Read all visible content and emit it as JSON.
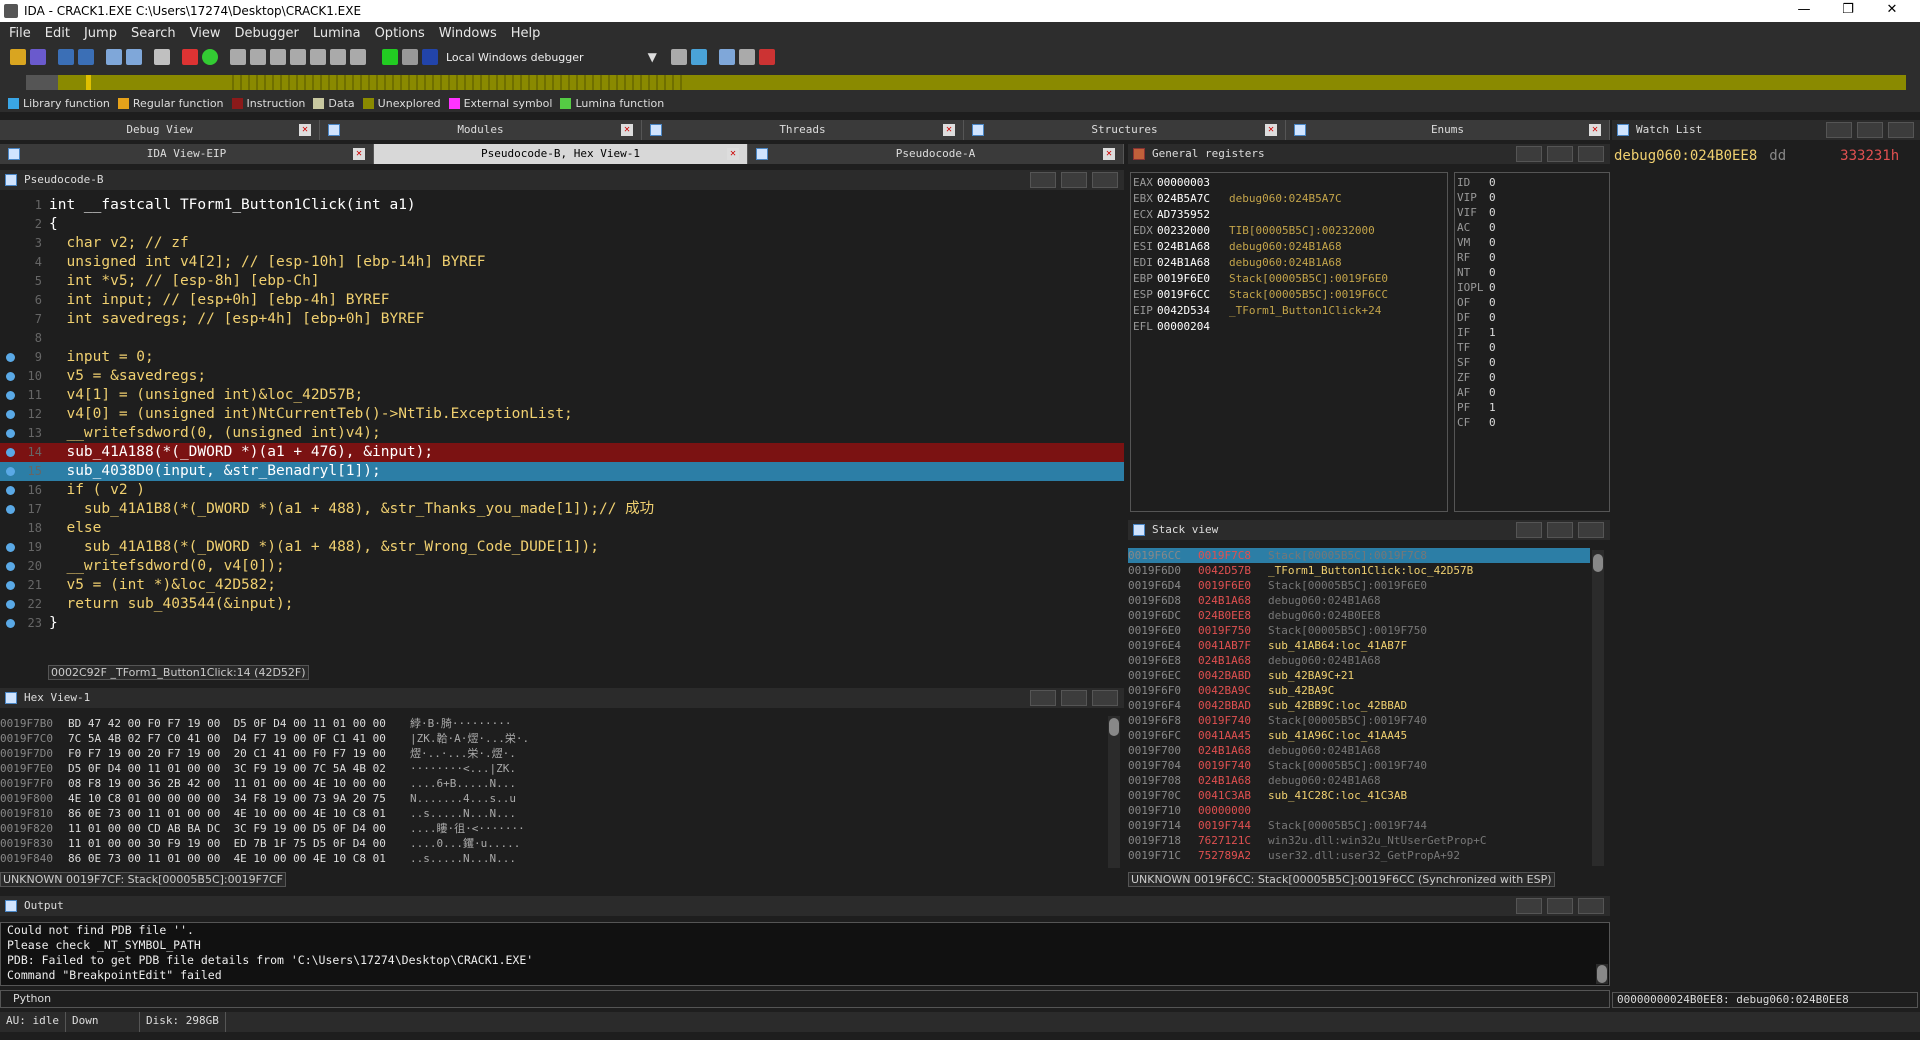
{
  "window": {
    "title": "IDA - CRACK1.EXE C:\\Users\\17274\\Desktop\\CRACK1.EXE",
    "minimize": "—",
    "maximize": "❐",
    "close": "✕"
  },
  "menu": [
    "File",
    "Edit",
    "Jump",
    "Search",
    "View",
    "Debugger",
    "Lumina",
    "Options",
    "Windows",
    "Help"
  ],
  "toolbar": {
    "debugger_select": "Local Windows debugger"
  },
  "legend": [
    {
      "label": "Library function",
      "color": "#3aa6e6"
    },
    {
      "label": "Regular function",
      "color": "#e6a21a"
    },
    {
      "label": "Instruction",
      "color": "#8b1a1a"
    },
    {
      "label": "Data",
      "color": "#c8c8a0"
    },
    {
      "label": "Unexplored",
      "color": "#8a8a00"
    },
    {
      "label": "External symbol",
      "color": "#ff33ff"
    },
    {
      "label": "Lumina function",
      "color": "#55cc44"
    }
  ],
  "tabs_top": [
    "Debug View",
    "Modules",
    "Threads",
    "Structures",
    "Enums"
  ],
  "tabs_second": [
    "IDA View-EIP",
    "Pseudocode-B, Hex View-1",
    "Pseudocode-A"
  ],
  "panels": {
    "pseudocode": "Pseudocode-B",
    "general_registers": "General registers",
    "watch_list": "Watch List",
    "stack_view": "Stack view",
    "hex_view": "Hex View-1",
    "output": "Output"
  },
  "code_lines": [
    {
      "n": "1",
      "t": "int __fastcall TForm1_Button1Click(int a1)",
      "bp": false
    },
    {
      "n": "2",
      "t": "{",
      "bp": false
    },
    {
      "n": "3",
      "t": "  char v2; // zf",
      "bp": false
    },
    {
      "n": "4",
      "t": "  unsigned int v4[2]; // [esp-10h] [ebp-14h] BYREF",
      "bp": false
    },
    {
      "n": "5",
      "t": "  int *v5; // [esp-8h] [ebp-Ch]",
      "bp": false
    },
    {
      "n": "6",
      "t": "  int input; // [esp+0h] [ebp-4h] BYREF",
      "bp": false
    },
    {
      "n": "7",
      "t": "  int savedregs; // [esp+4h] [ebp+0h] BYREF",
      "bp": false
    },
    {
      "n": "8",
      "t": "",
      "bp": false
    },
    {
      "n": "9",
      "t": "  input = 0;",
      "bp": true
    },
    {
      "n": "10",
      "t": "  v5 = &savedregs;",
      "bp": true
    },
    {
      "n": "11",
      "t": "  v4[1] = (unsigned int)&loc_42D57B;",
      "bp": true
    },
    {
      "n": "12",
      "t": "  v4[0] = (unsigned int)NtCurrentTeb()->NtTib.ExceptionList;",
      "bp": true
    },
    {
      "n": "13",
      "t": "  __writefsdword(0, (unsigned int)v4);",
      "bp": true
    },
    {
      "n": "14",
      "t": "  sub_41A188(*(_DWORD *)(a1 + 476), &input);",
      "bp": true,
      "hl": "red"
    },
    {
      "n": "15",
      "t": "  sub_4038D0(input, &str_Benadryl[1]);",
      "bp": true,
      "hl": "blue"
    },
    {
      "n": "16",
      "t": "  if ( v2 )",
      "bp": true
    },
    {
      "n": "17",
      "t": "    sub_41A1B8(*(_DWORD *)(a1 + 488), &str_Thanks_you_made[1]);// 成功",
      "bp": true
    },
    {
      "n": "18",
      "t": "  else",
      "bp": false
    },
    {
      "n": "19",
      "t": "    sub_41A1B8(*(_DWORD *)(a1 + 488), &str_Wrong_Code_DUDE[1]);",
      "bp": true
    },
    {
      "n": "20",
      "t": "  __writefsdword(0, v4[0]);",
      "bp": true
    },
    {
      "n": "21",
      "t": "  v5 = (int *)&loc_42D582;",
      "bp": true
    },
    {
      "n": "22",
      "t": "  return sub_403544(&input);",
      "bp": true
    },
    {
      "n": "23",
      "t": "}",
      "bp": true
    }
  ],
  "code_status": "0002C92F _TForm1_Button1Click:14 (42D52F)",
  "hex_rows": [
    {
      "a": "0019F7B0",
      "b": "BD 47 42 00 F0 F7 19 00  D5 0F D4 00 11 01 00 00",
      "c": "綍·B·䐀·········"
    },
    {
      "a": "0019F7C0",
      "b": "7C 5A 4B 02 F7 C0 41 00  D4 F7 19 00 0F C1 41 00",
      "c": "|ZK.韐·A·熤·...栄·."
    },
    {
      "a": "0019F7D0",
      "b": "F0 F7 19 00 20 F7 19 00  20 C1 41 00 F0 F7 19 00",
      "c": "熤·..·...栄·.熤·."
    },
    {
      "a": "0019F7E0",
      "b": "D5 0F D4 00 11 01 00 00  3C F9 19 00 7C 5A 4B 02",
      "c": "········<...|ZK."
    },
    {
      "a": "0019F7F0",
      "b": "08 F8 19 00 36 2B 42 00  11 01 00 00 4E 10 00 00",
      "c": "....6+B.....N..."
    },
    {
      "a": "0019F800",
      "b": "4E 10 C8 01 00 00 00 00  34 F8 19 00 73 9A 20 75",
      "c": "N.......4...s..u"
    },
    {
      "a": "0019F810",
      "b": "86 0E 73 00 11 01 00 00  4E 10 00 00 4E 10 C8 01",
      "c": "..s.....N...N..."
    },
    {
      "a": "0019F820",
      "b": "11 01 00 00 CD AB BA DC  3C F9 19 00 D5 0F D4 00",
      "c": "....瞜·徂·<·······"
    },
    {
      "a": "0019F830",
      "b": "11 01 00 00 30 F9 19 00  ED 7B 1F 75 D5 0F D4 00",
      "c": "....0...钁·u....."
    },
    {
      "a": "0019F840",
      "b": "86 0E 73 00 11 01 00 00  4E 10 00 00 4E 10 C8 01",
      "c": "..s.....N...N..."
    }
  ],
  "hex_status": "UNKNOWN 0019F7CF: Stack[00005B5C]:0019F7CF",
  "registers": [
    {
      "n": "EAX",
      "v": "00000003",
      "d": ""
    },
    {
      "n": "EBX",
      "v": "024B5A7C",
      "d": "debug060:024B5A7C"
    },
    {
      "n": "ECX",
      "v": "AD735952",
      "d": ""
    },
    {
      "n": "EDX",
      "v": "00232000",
      "d": "TIB[00005B5C]:00232000"
    },
    {
      "n": "ESI",
      "v": "024B1A68",
      "d": "debug060:024B1A68"
    },
    {
      "n": "EDI",
      "v": "024B1A68",
      "d": "debug060:024B1A68"
    },
    {
      "n": "EBP",
      "v": "0019F6E0",
      "d": "Stack[00005B5C]:0019F6E0"
    },
    {
      "n": "ESP",
      "v": "0019F6CC",
      "d": "Stack[00005B5C]:0019F6CC"
    },
    {
      "n": "EIP",
      "v": "0042D534",
      "d": "_TForm1_Button1Click+24"
    },
    {
      "n": "EFL",
      "v": "00000204",
      "d": ""
    }
  ],
  "flags": [
    {
      "n": "ID",
      "v": "0"
    },
    {
      "n": "VIP",
      "v": "0"
    },
    {
      "n": "VIF",
      "v": "0"
    },
    {
      "n": "AC",
      "v": "0"
    },
    {
      "n": "VM",
      "v": "0"
    },
    {
      "n": "RF",
      "v": "0"
    },
    {
      "n": "NT",
      "v": "0"
    },
    {
      "n": "IOPL",
      "v": "0"
    },
    {
      "n": "OF",
      "v": "0"
    },
    {
      "n": "DF",
      "v": "0"
    },
    {
      "n": "IF",
      "v": "1"
    },
    {
      "n": "TF",
      "v": "0"
    },
    {
      "n": "SF",
      "v": "0"
    },
    {
      "n": "ZF",
      "v": "0"
    },
    {
      "n": "AF",
      "v": "0"
    },
    {
      "n": "PF",
      "v": "1"
    },
    {
      "n": "CF",
      "v": "0"
    }
  ],
  "stack_rows": [
    {
      "a": "0019F6CC",
      "v": "0019F7C8",
      "d": "Stack[00005B5C]:0019F7C8",
      "sel": true
    },
    {
      "a": "0019F6D0",
      "v": "0042D57B",
      "d": "_TForm1_Button1Click:loc_42D57B",
      "y": true
    },
    {
      "a": "0019F6D4",
      "v": "0019F6E0",
      "d": "Stack[00005B5C]:0019F6E0"
    },
    {
      "a": "0019F6D8",
      "v": "024B1A68",
      "d": "debug060:024B1A68"
    },
    {
      "a": "0019F6DC",
      "v": "024B0EE8",
      "d": "debug060:024B0EE8"
    },
    {
      "a": "0019F6E0",
      "v": "0019F750",
      "d": "Stack[00005B5C]:0019F750"
    },
    {
      "a": "0019F6E4",
      "v": "0041AB7F",
      "d": "sub_41AB64:loc_41AB7F",
      "y": true
    },
    {
      "a": "0019F6E8",
      "v": "024B1A68",
      "d": "debug060:024B1A68"
    },
    {
      "a": "0019F6EC",
      "v": "0042BABD",
      "d": "sub_42BA9C+21",
      "y": true
    },
    {
      "a": "0019F6F0",
      "v": "0042BA9C",
      "d": "sub_42BA9C",
      "y": true
    },
    {
      "a": "0019F6F4",
      "v": "0042BBAD",
      "d": "sub_42BB9C:loc_42BBAD",
      "y": true
    },
    {
      "a": "0019F6F8",
      "v": "0019F740",
      "d": "Stack[00005B5C]:0019F740"
    },
    {
      "a": "0019F6FC",
      "v": "0041AA45",
      "d": "sub_41A96C:loc_41AA45",
      "y": true
    },
    {
      "a": "0019F700",
      "v": "024B1A68",
      "d": "debug060:024B1A68"
    },
    {
      "a": "0019F704",
      "v": "0019F740",
      "d": "Stack[00005B5C]:0019F740"
    },
    {
      "a": "0019F708",
      "v": "024B1A68",
      "d": "debug060:024B1A68"
    },
    {
      "a": "0019F70C",
      "v": "0041C3AB",
      "d": "sub_41C28C:loc_41C3AB",
      "y": true
    },
    {
      "a": "0019F710",
      "v": "00000000",
      "d": ""
    },
    {
      "a": "0019F714",
      "v": "0019F744",
      "d": "Stack[00005B5C]:0019F744"
    },
    {
      "a": "0019F718",
      "v": "7627121C",
      "d": "win32u.dll:win32u_NtUserGetProp+C"
    },
    {
      "a": "0019F71C",
      "v": "752789A2",
      "d": "user32.dll:user32_GetPropA+92"
    }
  ],
  "stack_status": "UNKNOWN 0019F6CC: Stack[00005B5C]:0019F6CC (Synchronized with ESP)",
  "watch": {
    "addr": "debug060:024B0EE8",
    "dir": "dd",
    "val": "333231h"
  },
  "output_lines": [
    "Could not find PDB file ''.",
    "Please check _NT_SYMBOL_PATH",
    "PDB: Failed to get PDB file details from 'C:\\Users\\17274\\Desktop\\CRACK1.EXE'",
    "Command \"BreakpointEdit\" failed"
  ],
  "python_label": "Python",
  "status": {
    "au": "AU:  idle",
    "dir": "Down",
    "disk": "Disk: 298GB"
  },
  "right_status": "00000000024B0EE8: debug060:024B0EE8"
}
